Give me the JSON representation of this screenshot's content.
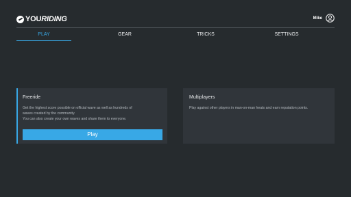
{
  "header": {
    "logo_text_1": "YOU",
    "logo_text_2": "RIDING",
    "user_name": "Mike"
  },
  "tabs": [
    {
      "label": "PLAY",
      "active": true
    },
    {
      "label": "GEAR",
      "active": false
    },
    {
      "label": "TRICKS",
      "active": false
    },
    {
      "label": "SETTINGS",
      "active": false
    }
  ],
  "cards": {
    "freeride": {
      "title": "Freeride",
      "desc_lines": [
        "Get the highest score possible on official wave as well as hundreds of",
        "waves created by the community.",
        "You can also create your own waves and share them to everyone."
      ],
      "button_label": "Play"
    },
    "multiplayers": {
      "title": "Multiplayers",
      "desc_lines": [
        "Play against other players in man-on-man heats and earn reputation points."
      ]
    }
  },
  "colors": {
    "background": "#262b2e",
    "card": "#30353a",
    "accent": "#38a8e6"
  },
  "icons": {
    "logo": "youriding-logo-icon",
    "user": "user-avatar-icon"
  }
}
